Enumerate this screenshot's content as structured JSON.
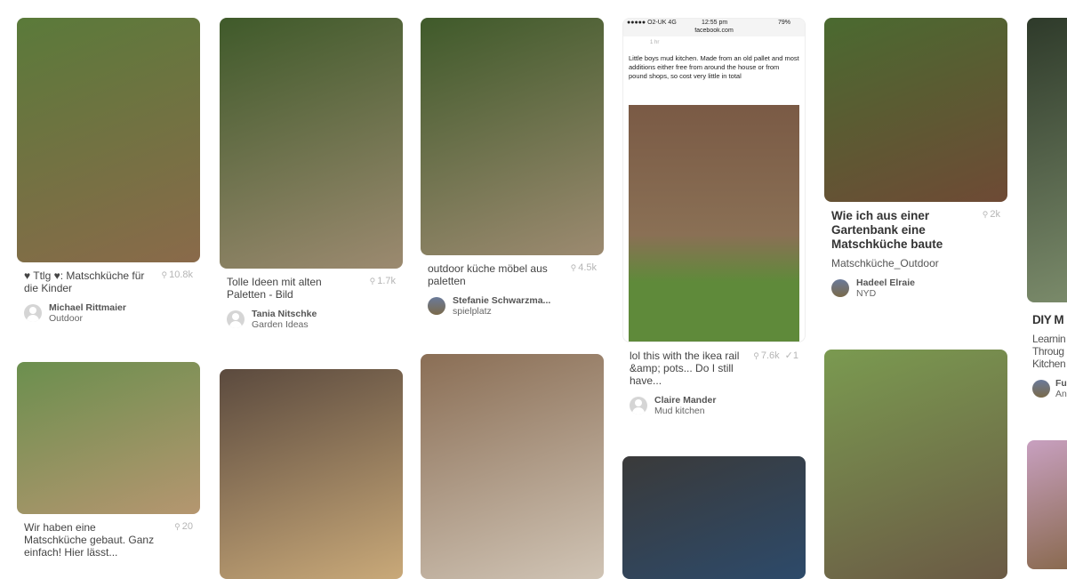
{
  "pins": [
    {
      "title": "♥ Ttlg ♥: Matschküche für die Kinder",
      "saves": "10.8k",
      "user": "Michael Rittmaier",
      "board": "Outdoor",
      "colors": [
        "#5a7a3a",
        "#8a6a4a"
      ]
    },
    {
      "title": "Wir haben eine Matschküche gebaut. Ganz einfach! Hier lässt...",
      "saves": "20",
      "colors": [
        "#6b8f4e",
        "#b59670"
      ]
    },
    {
      "title": "Tolle Ideen mit alten Paletten - Bild",
      "saves": "1.7k",
      "user": "Tania Nitschke",
      "board": "Garden Ideas",
      "colors": [
        "#3f5a2a",
        "#9c8a70"
      ]
    },
    {
      "colors": [
        "#5b4a3e",
        "#c9a979"
      ]
    },
    {
      "title": "outdoor küche möbel aus paletten",
      "saves": "4.5k",
      "user": "Stefanie Schwarzma...",
      "board": "spielplatz",
      "colors": [
        "#3f5a2a",
        "#9c8a70"
      ]
    },
    {
      "colors": [
        "#8a6e55",
        "#d0c4b5"
      ]
    },
    {
      "title": "lol this with the ikea rail &amp; pots... Do I still have...",
      "saves": "7.6k",
      "tries": "1",
      "user": "Claire Mander",
      "board": "Mud kitchen",
      "colors": [
        "#7a5a45",
        "#5f8a3a"
      ],
      "screenshot": {
        "carrier": "●●●●● O2-UK  4G",
        "time": "12:55 pm",
        "battery": "79%",
        "url": "facebook.com",
        "post_time": "1 hr",
        "post_text": "Little boys mud kitchen. Made from an old pallet and most additions either free from around the house or from pound shops, so cost very little in total"
      }
    },
    {
      "colors": [
        "#3a3a3a",
        "#2d4a6a"
      ]
    },
    {
      "title": "Wie ich aus einer Gartenbank eine Matschküche baute",
      "saves": "2k",
      "description": "Matschküche_Outdoor",
      "user": "Hadeel Elraie",
      "board": "NYD",
      "colors": [
        "#4a6a30",
        "#6e4a35"
      ]
    },
    {
      "colors": [
        "#7a9a50",
        "#6b5a45"
      ]
    },
    {
      "title": "DIY M",
      "description": "Learnin Throug Kitchen",
      "user": "Fu",
      "board": "An",
      "colors": [
        "#2e3a2a",
        "#7a8a6a"
      ]
    },
    {
      "colors": [
        "#c8a0c0",
        "#8a6a50"
      ]
    }
  ]
}
